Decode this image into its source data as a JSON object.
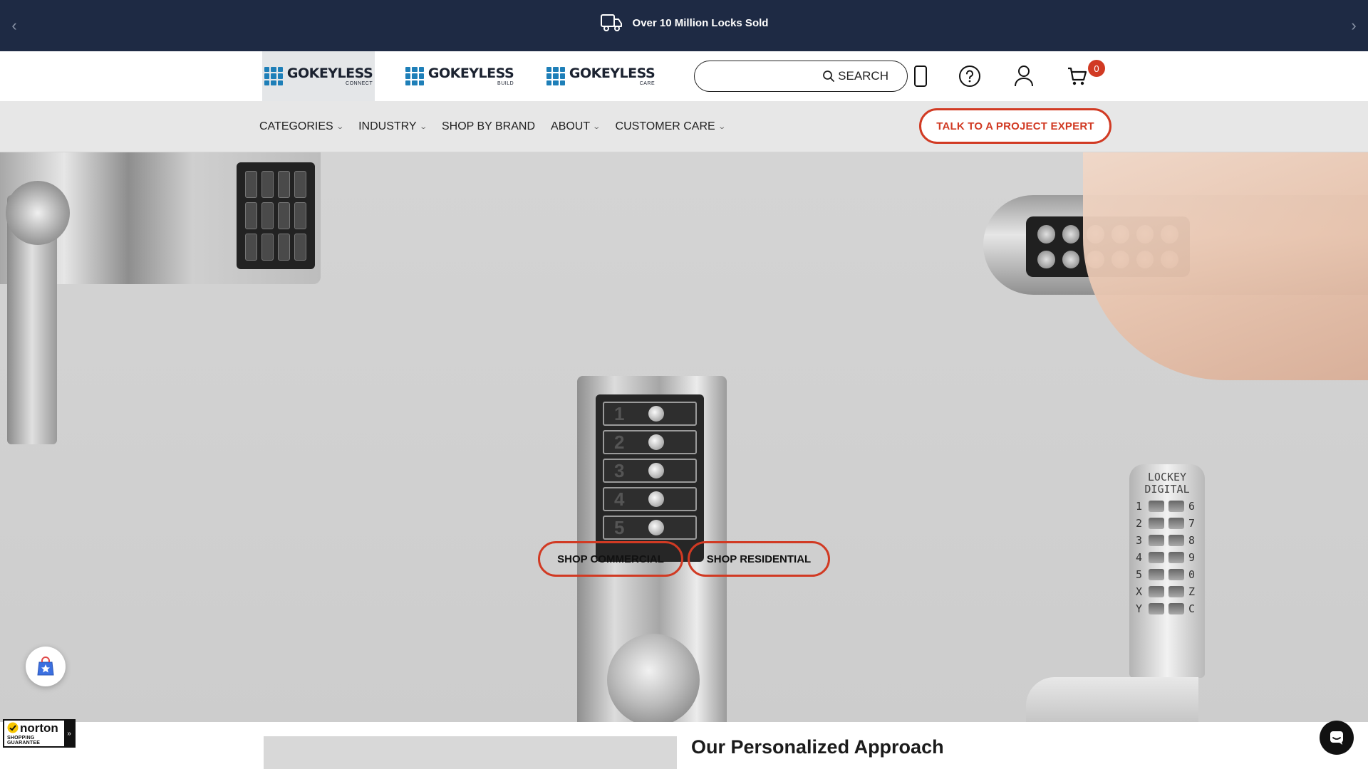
{
  "announcement": {
    "text": "Over 10 Million Locks Sold"
  },
  "header": {
    "brands": [
      {
        "name": "GOKEYLESS",
        "sub": "CONNECT"
      },
      {
        "name": "GOKEYLESS",
        "sub": "BUILD"
      },
      {
        "name": "GOKEYLESS",
        "sub": "CARE"
      }
    ],
    "search": {
      "placeholder": "",
      "button_label": "SEARCH"
    },
    "cart_count": "0"
  },
  "nav": {
    "items": [
      {
        "label": "CATEGORIES"
      },
      {
        "label": "INDUSTRY"
      },
      {
        "label": "SHOP BY BRAND"
      },
      {
        "label": "ABOUT"
      },
      {
        "label": "CUSTOMER CARE"
      }
    ],
    "cta_label": "TALK TO A PROJECT EXPERT"
  },
  "hero": {
    "buttons": [
      {
        "label": "SHOP COMMERCIAL"
      },
      {
        "label": "SHOP RESIDENTIAL"
      }
    ],
    "lock_b_digits": [
      "1",
      "2",
      "3",
      "4",
      "5"
    ],
    "lock_d_brand": [
      "LOCKEY",
      "DIGITAL"
    ],
    "lock_d_keys": [
      [
        "1",
        "6"
      ],
      [
        "2",
        "7"
      ],
      [
        "3",
        "8"
      ],
      [
        "4",
        "9"
      ],
      [
        "5",
        "0"
      ],
      [
        "X",
        "Z"
      ],
      [
        "Y",
        "C"
      ]
    ]
  },
  "section": {
    "title": "Our Personalized Approach"
  },
  "norton": {
    "name": "norton",
    "sub": "SHOPPING GUARANTEE"
  },
  "colors": {
    "dark_bar": "#1e2a44",
    "accent": "#d13a23",
    "nav_bg": "#e7e7e7",
    "brand_blue": "#1e7fb8"
  }
}
